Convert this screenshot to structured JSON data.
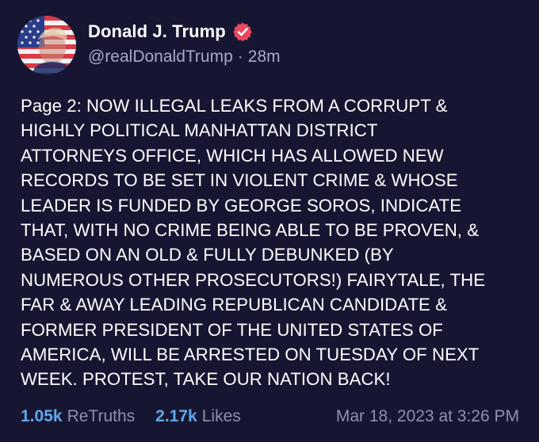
{
  "post": {
    "author": {
      "display_name": "Donald J. Trump",
      "handle": "@realDonaldTrump",
      "verified_icon": "verified-badge-icon",
      "avatar": "profile-avatar-flag-portrait"
    },
    "relative_time": "28m",
    "separator": "·",
    "text": "Page 2: NOW ILLEGAL LEAKS FROM A CORRUPT &\nHIGHLY POLITICAL MANHATTAN DISTRICT\nATTORNEYS OFFICE, WHICH HAS ALLOWED NEW\nRECORDS TO BE SET IN VIOLENT CRIME & WHOSE\nLEADER IS FUNDED BY GEORGE SOROS, INDICATE\nTHAT, WITH NO CRIME BEING ABLE TO BE PROVEN, &\nBASED ON AN OLD & FULLY DEBUNKED (BY\nNUMEROUS OTHER PROSECUTORS!) FAIRYTALE, THE\nFAR & AWAY LEADING REPUBLICAN CANDIDATE &\nFORMER PRESIDENT OF THE UNITED STATES OF\nAMERICA, WILL BE ARRESTED ON TUESDAY OF NEXT\nWEEK. PROTEST, TAKE OUR NATION BACK!",
    "stats": {
      "retruths_count": "1.05k",
      "retruths_label": "ReTruths",
      "likes_count": "2.17k",
      "likes_label": "Likes"
    },
    "timestamp": "Mar 18, 2023 at 3:26 PM"
  },
  "colors": {
    "background": "#171632",
    "text": "#ffffff",
    "muted": "#a9a9c2",
    "stat_accent": "#5fa8e8",
    "verified_badge": "#e8485e"
  }
}
